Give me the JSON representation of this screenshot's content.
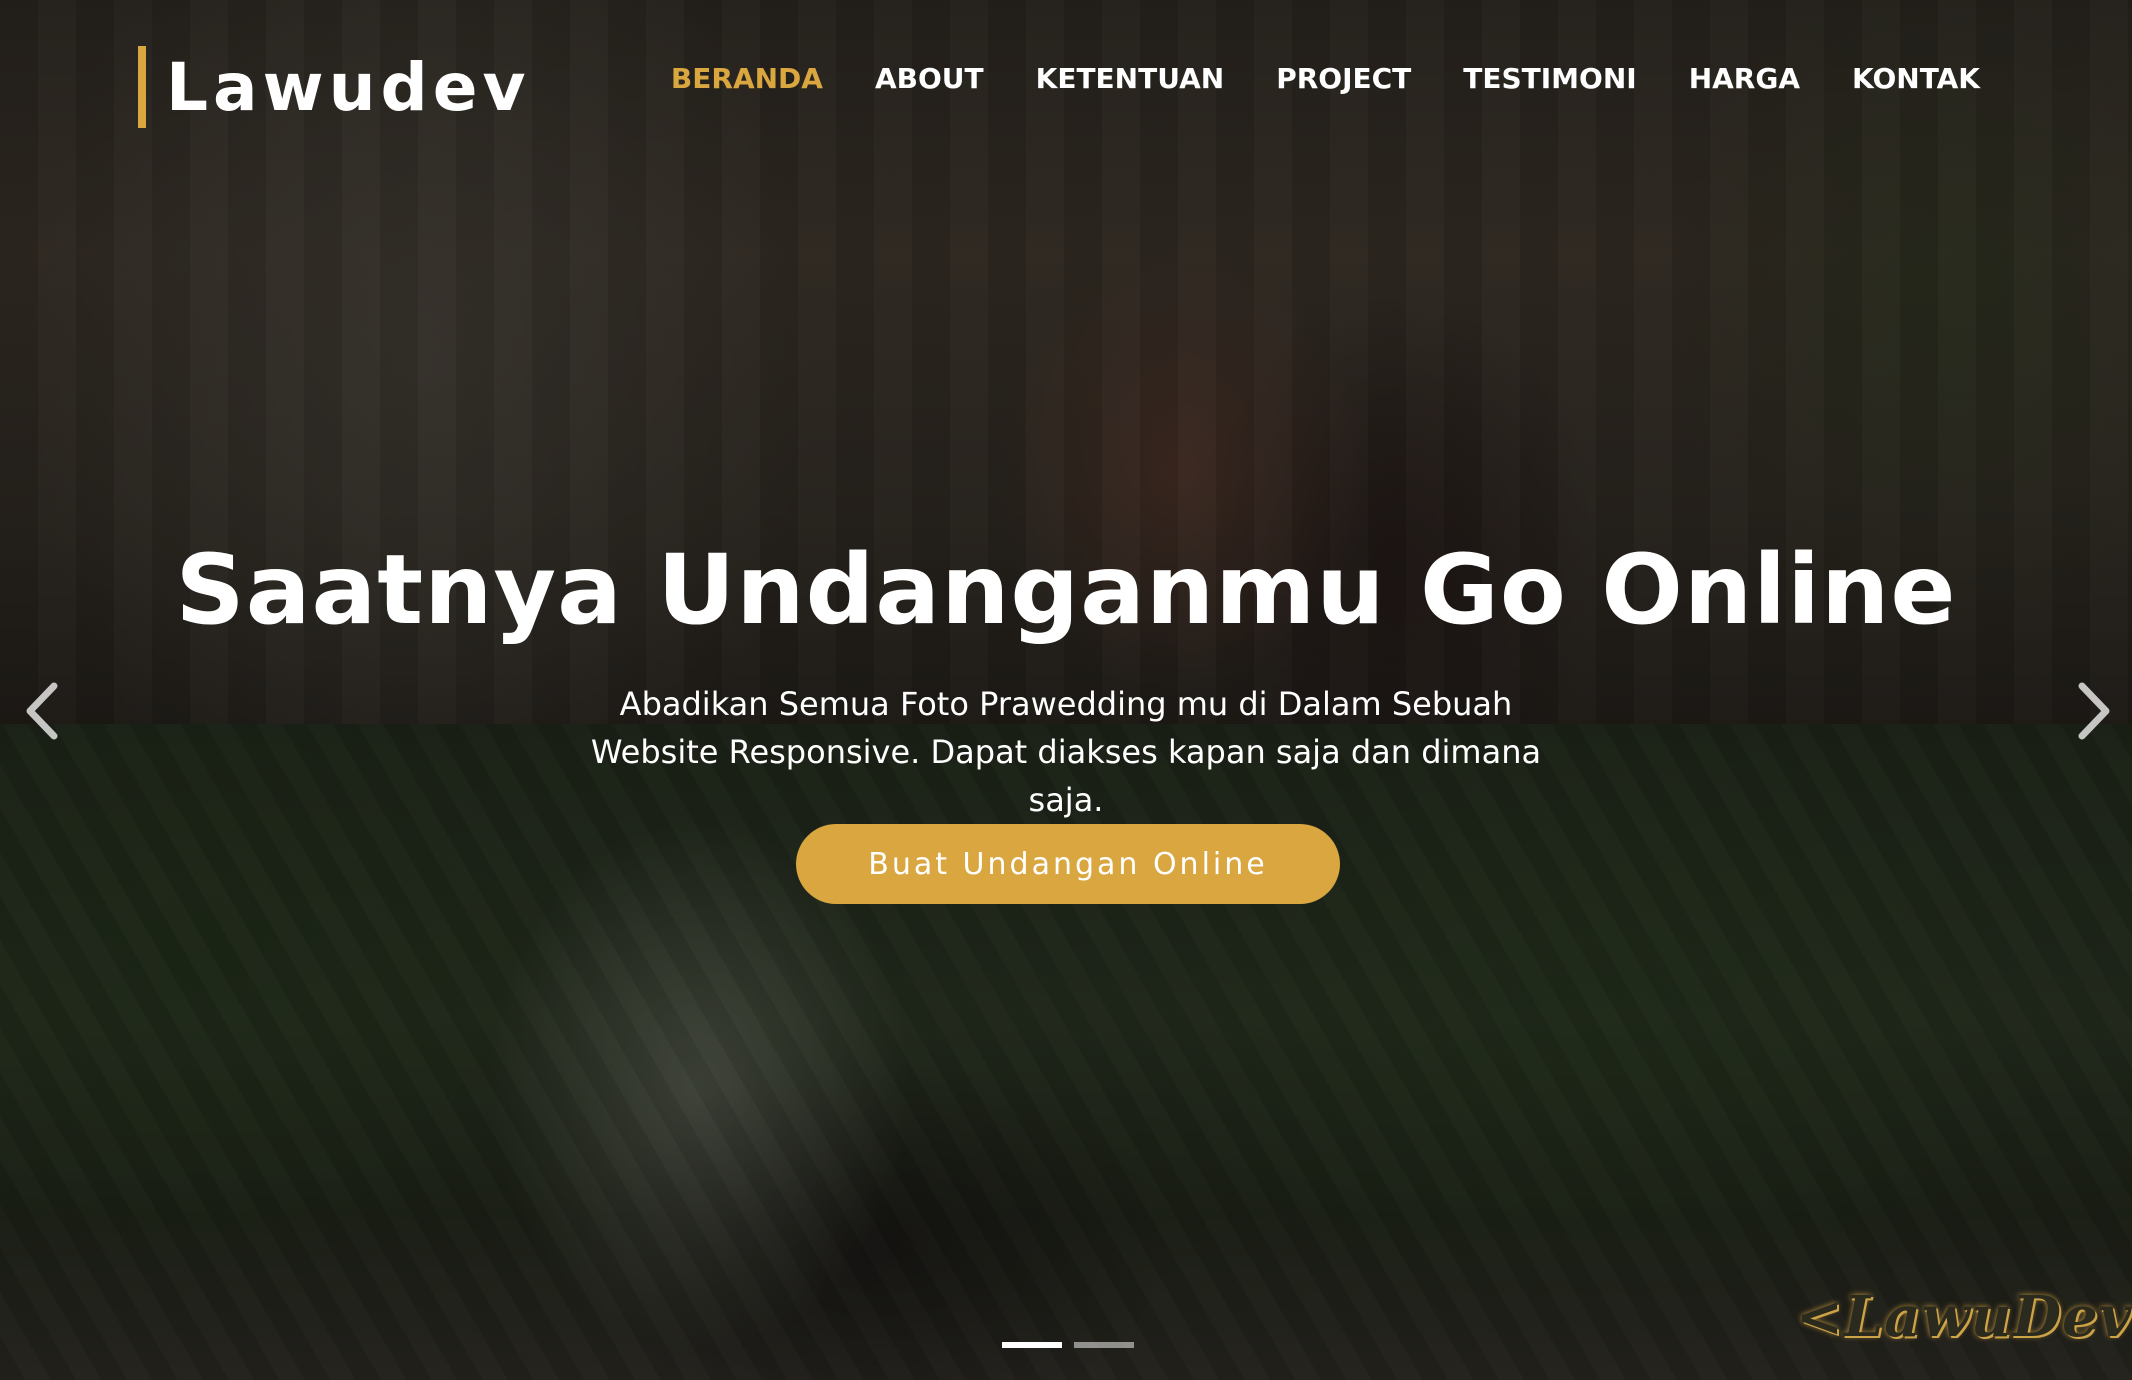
{
  "brand": {
    "name": "Lawudev",
    "accent_color": "#d9a640"
  },
  "nav": {
    "items": [
      {
        "label": "BERANDA",
        "active": true
      },
      {
        "label": "ABOUT",
        "active": false
      },
      {
        "label": "KETENTUAN",
        "active": false
      },
      {
        "label": "PROJECT",
        "active": false
      },
      {
        "label": "TESTIMONI",
        "active": false
      },
      {
        "label": "HARGA",
        "active": false
      },
      {
        "label": "KONTAK",
        "active": false
      }
    ]
  },
  "hero": {
    "headline": "Saatnya Undanganmu Go Online",
    "subtext": "Abadikan Semua Foto Prawedding mu di Dalam Sebuah Website Responsive. Dapat diakses kapan saja dan dimana saja.",
    "cta_label": "Buat Undangan Online",
    "cta_color": "#d9a640"
  },
  "carousel": {
    "prev_icon": "chevron-left-icon",
    "next_icon": "chevron-right-icon",
    "slide_count": 2,
    "active_index": 0
  },
  "watermark": {
    "text": "<LawuDev>"
  }
}
